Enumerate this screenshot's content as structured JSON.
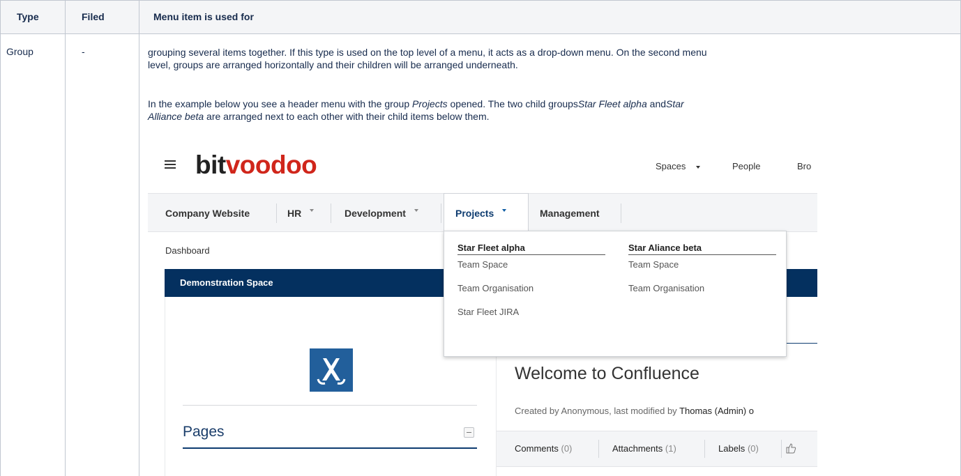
{
  "table": {
    "headers": [
      "Type",
      "Filed",
      "Menu item is used for"
    ],
    "row": {
      "type": "Group",
      "filed": "-",
      "description": {
        "p1_line1": "grouping several items together. If this type is used on the top level of a menu, it acts as a drop-down menu. On the second menu",
        "p1_line2": "level, groups are arranged horizontally and their children will be arranged underneath.",
        "p2_a": "In the example below you see a header menu with the group ",
        "p2_b": "Projects",
        "p2_c": " opened. The two child groups",
        "p2_d": "Star Fleet alpha",
        "p2_e": " and",
        "p2_f": "Star",
        "p2_g": "Alliance beta",
        "p2_h": " are arranged next to each other with their child items below them."
      }
    }
  },
  "screenshot": {
    "logo_part1": "bit",
    "logo_part2": "voodoo",
    "top_nav": [
      "Spaces",
      "People",
      "Bro"
    ],
    "menu": [
      "Company Website",
      "HR",
      "Development",
      "Projects",
      "Management"
    ],
    "breadcrumb": "Dashboard",
    "space_title": "Demonstration Space",
    "dropdown": {
      "groups": [
        {
          "title": "Star Fleet alpha",
          "items": [
            "Team Space",
            "Team Organisation",
            "Star Fleet JIRA"
          ]
        },
        {
          "title": "Star Aliance beta",
          "items": [
            "Team Space",
            "Team Organisation"
          ]
        }
      ]
    },
    "sidebar_heading": "Pages",
    "page_title": "Welcome to Confluence",
    "byline_a": "Created by Anonymous, last modified by ",
    "byline_b": "Thomas (Admin) o",
    "tabs": [
      {
        "label": "Comments",
        "count": "(0)"
      },
      {
        "label": "Attachments",
        "count": "(1)"
      },
      {
        "label": "Labels",
        "count": "(0)"
      }
    ],
    "colors": {
      "brand_red": "#d0261b",
      "space_blue": "#04305f",
      "link_navy": "#0e3c70"
    }
  }
}
